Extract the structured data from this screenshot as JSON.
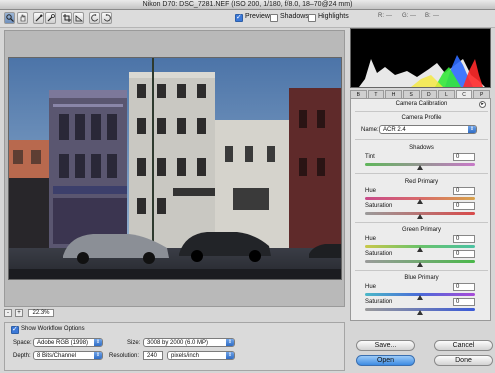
{
  "window": {
    "title": "Nikon D70:  DSC_7281.NEF  (ISO 200, 1/180, f/8.0, 18–70@24 mm)"
  },
  "toolbar": {
    "tools": [
      "zoom-icon",
      "hand-icon",
      "eyedropper-icon",
      "color-sampler-icon",
      "crop-icon",
      "straighten-icon",
      "rotate-left-icon",
      "rotate-right-icon"
    ],
    "preview_label": "Preview",
    "shadows_label": "Shadows",
    "highlights_label": "Highlights",
    "preview_checked": true,
    "shadows_checked": false,
    "highlights_checked": false,
    "r_label": "R:",
    "g_label": "G:",
    "b_label": "B:",
    "r_value": "---",
    "g_value": "---",
    "b_value": "---"
  },
  "zoom": {
    "minus": "-",
    "plus": "+",
    "value": "22.3%"
  },
  "tabs": [
    "B",
    "T",
    "H",
    "S",
    "D",
    "L",
    "C",
    "P"
  ],
  "active_tab": "C",
  "panel": {
    "title": "Camera Calibration",
    "camera_profile_label": "Camera Profile",
    "name_label": "Name:",
    "name_value": "ACR 2.4",
    "shadows_head": "Shadows",
    "tint_label": "Tint",
    "tint_value": "0",
    "red_head": "Red Primary",
    "green_head": "Green Primary",
    "blue_head": "Blue Primary",
    "hue_label": "Hue",
    "saturation_label": "Saturation",
    "red_hue": "0",
    "red_sat": "0",
    "green_hue": "0",
    "green_sat": "0",
    "blue_hue": "0",
    "blue_sat": "0"
  },
  "workflow": {
    "show_label": "Show Workflow Options",
    "show_checked": true,
    "space_label": "Space:",
    "space_value": "Adobe RGB (1998)",
    "depth_label": "Depth:",
    "depth_value": "8 Bits/Channel",
    "size_label": "Size:",
    "size_value": "3008 by 2000  (6.0 MP)",
    "resolution_label": "Resolution:",
    "resolution_value": "240",
    "resolution_unit": "pixels/inch"
  },
  "buttons": {
    "save": "Save...",
    "cancel": "Cancel",
    "open": "Open",
    "done": "Done"
  },
  "colors": {
    "accent": "#3d8be3",
    "tint_track": "#8ec97a",
    "red_track": "#d86a6a",
    "green_track": "#7ac27a",
    "blue_track": "#6f7fd8"
  }
}
